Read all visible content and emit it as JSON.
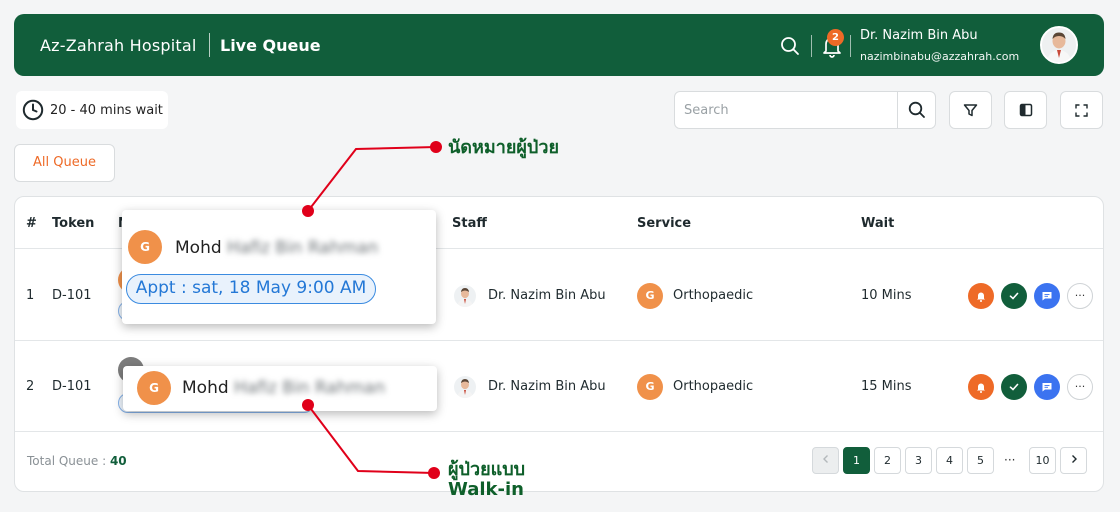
{
  "header": {
    "hospital_name": "Az-Zahrah Hospital",
    "page_title": "Live Queue",
    "notification_count": "2",
    "user_name": "Dr. Nazim Bin Abu",
    "user_email": "nazimbinabu@azzahrah.com"
  },
  "wait": {
    "text": "20 - 40 mins wait"
  },
  "search": {
    "placeholder": "Search"
  },
  "filter": {
    "all_queue": "All Queue"
  },
  "table": {
    "headers": {
      "index": "#",
      "token": "Token",
      "name": "N",
      "staff": "Staff",
      "service": "Service",
      "wait": "Wait"
    },
    "rows": [
      {
        "index": "1",
        "token": "D-101",
        "staff": "Dr. Nazim Bin Abu",
        "service_initial": "G",
        "service": "Orthopaedic",
        "wait": "10 Mins"
      },
      {
        "index": "2",
        "token": "D-101",
        "staff": "Dr. Nazim Bin Abu",
        "service_initial": "G",
        "service": "Orthopaedic",
        "wait": "15 Mins"
      }
    ],
    "more_label": "···"
  },
  "footer": {
    "total_label": "Total Queue : ",
    "total_value": "40",
    "pages": [
      "1",
      "2",
      "3",
      "4",
      "5"
    ],
    "ellipsis": "···",
    "last_page": "10",
    "current_page": 1
  },
  "popups": {
    "appointment": {
      "initial": "G",
      "first_name": "Mohd",
      "rest_name_blurred": "Hafiz Bin Rahman",
      "appt_text": "Appt : sat, 18 May 9:00 AM"
    },
    "walkin": {
      "initial": "G",
      "first_name": "Mohd",
      "rest_name_blurred": "Hafiz Bin Rahman"
    }
  },
  "annotations": {
    "appointment_label": "นัดหมายผู้ป่วย",
    "walkin_label_line1": "ผู้ป่วยแบบ",
    "walkin_label_line2": "Walk-in"
  },
  "colors": {
    "brand_green": "#115e3b",
    "accent_orange": "#ee6a27",
    "chat_blue": "#3b73f0",
    "annotation_red": "#e0001a"
  },
  "icons": [
    "search-icon",
    "bell-icon",
    "clock-icon",
    "filter-icon",
    "columns-icon",
    "fullscreen-icon",
    "check-icon",
    "chat-icon",
    "more-icon",
    "chevron-left-icon",
    "chevron-right-icon"
  ]
}
